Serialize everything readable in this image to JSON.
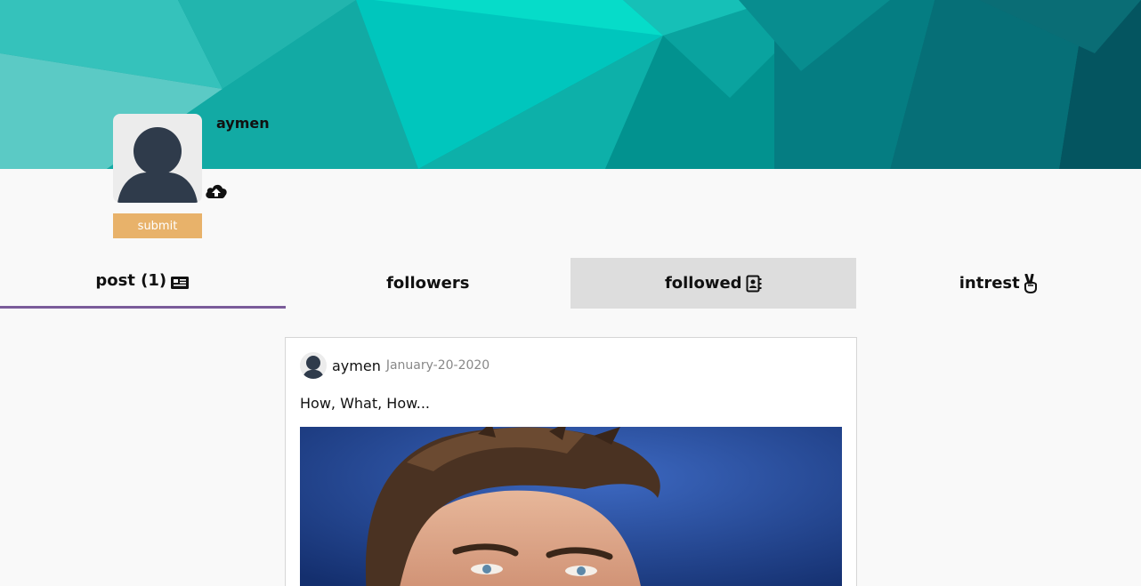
{
  "profile": {
    "name": "aymen",
    "submit_label": "submit"
  },
  "tabs": [
    {
      "label": "post (1)",
      "icon": "newspaper-icon"
    },
    {
      "label": "followers",
      "icon": ""
    },
    {
      "label": "followed",
      "icon": "address-book-icon"
    },
    {
      "label": "intrest",
      "icon": "peace-hand-icon"
    }
  ],
  "active_tab": "followed",
  "post": {
    "author": "aymen",
    "date": "January-20-2020",
    "text": "How, What, How..."
  },
  "colors": {
    "banner_teal": "#0fb3ad",
    "submit_bg": "#e8b26a",
    "tab_underline": "#7b5c9a",
    "active_tab_bg": "#dddddd",
    "avatar_dark": "#2f3b4b"
  }
}
